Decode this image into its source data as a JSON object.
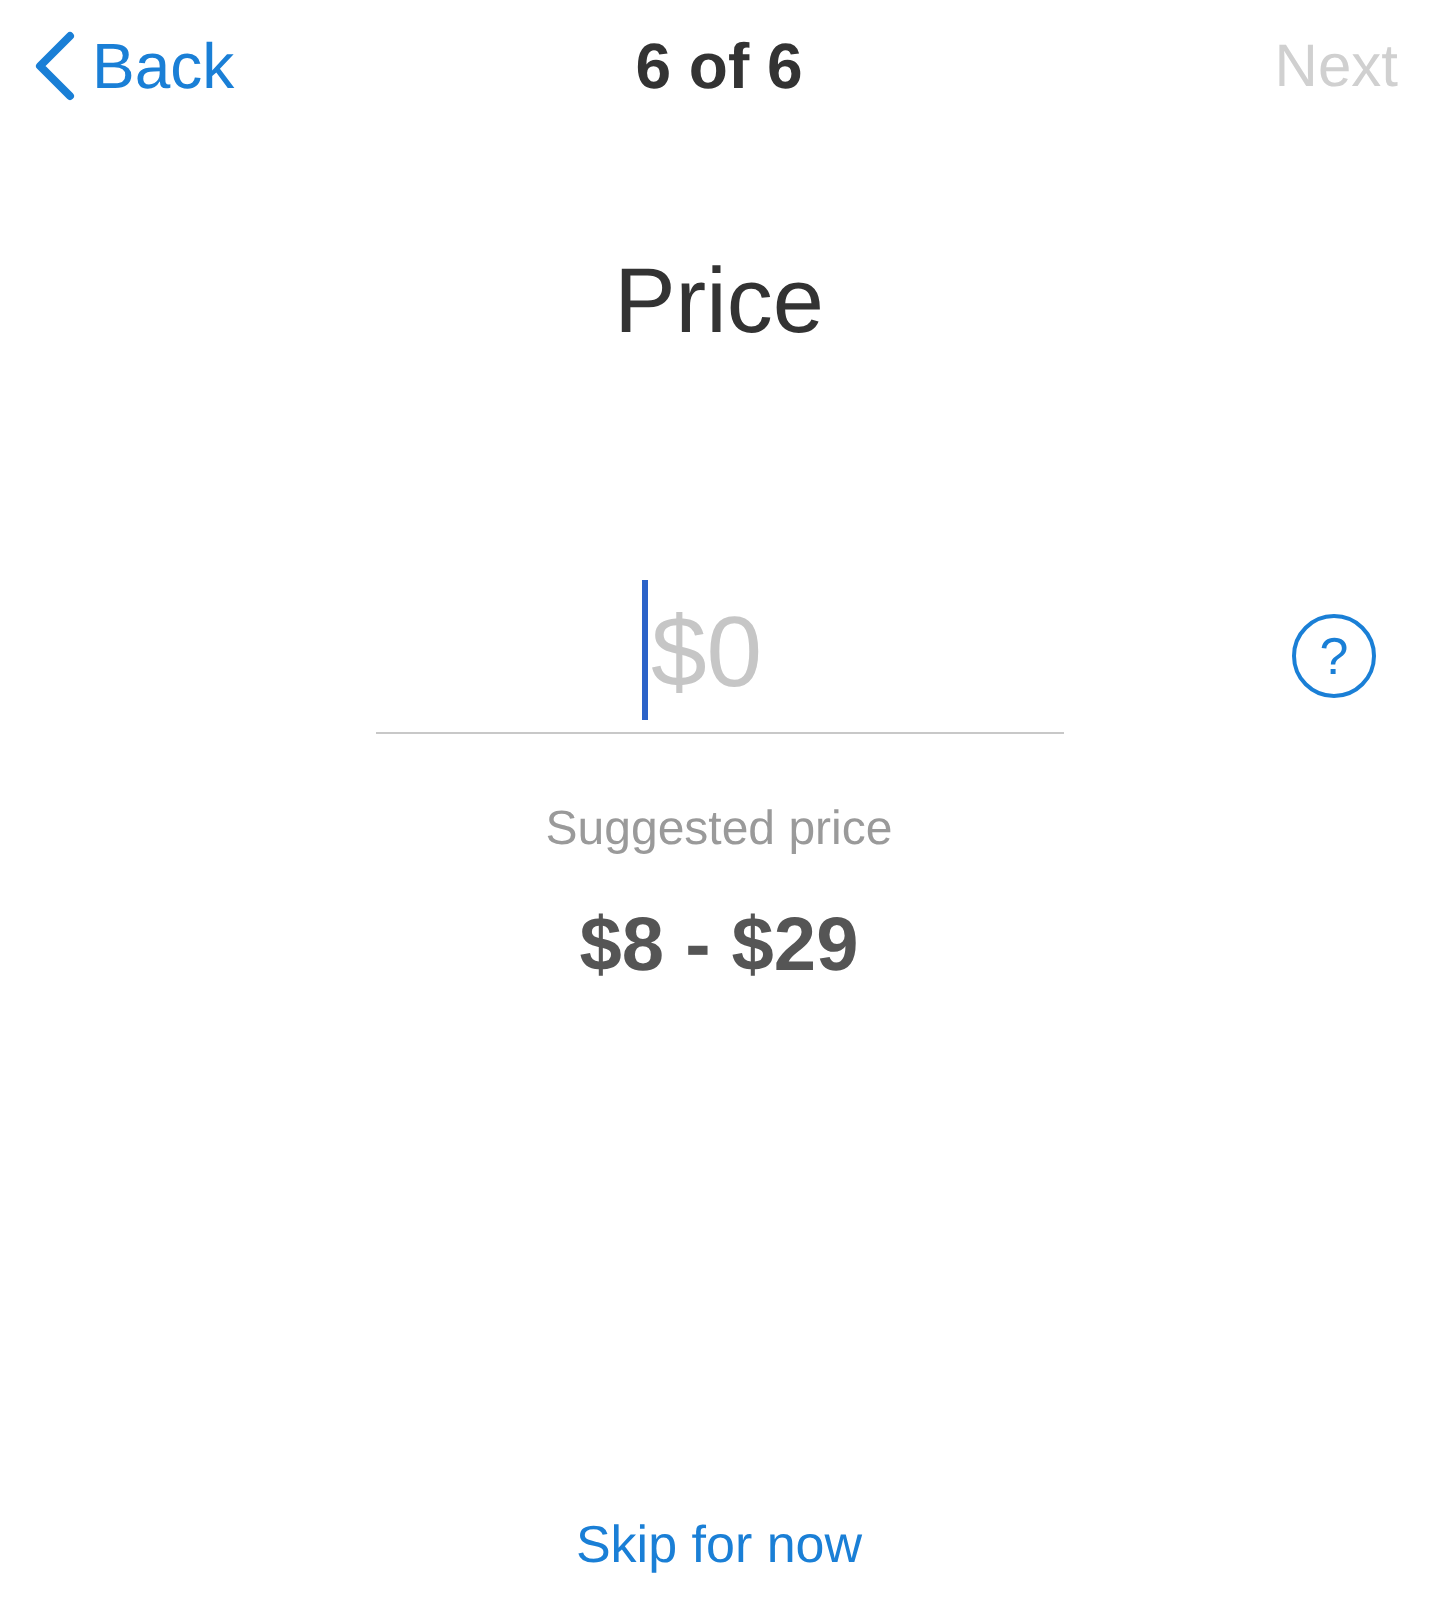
{
  "nav": {
    "back": "Back",
    "step": "6 of 6",
    "next": {
      "label": "Next",
      "disabled": true
    }
  },
  "title": "Price",
  "price_field": {
    "placeholder": "$0",
    "focused": true
  },
  "help_button": {
    "label": "?"
  },
  "suggestion": {
    "label": "Suggested price",
    "range": "$8 - $29"
  },
  "skip_link": "Skip for now"
}
